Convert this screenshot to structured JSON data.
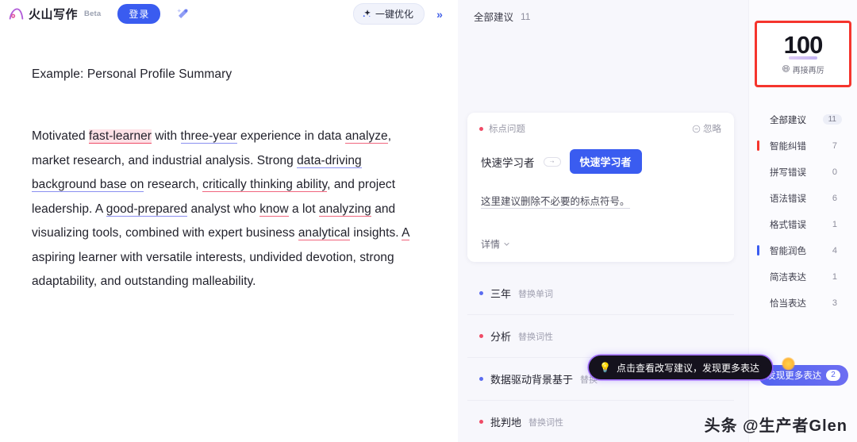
{
  "header": {
    "logo_text": "火山写作",
    "beta_tag": "Beta",
    "login_label": "登录",
    "magic_icon": "magic-wand-icon",
    "optimize_label": "一键优化",
    "spark_icon": "sparkle-icon",
    "expand_label": "»"
  },
  "document": {
    "title": "Example: Personal Profile Summary",
    "paragraph_segments": [
      {
        "text": "Motivated ",
        "mark": "none"
      },
      {
        "text": "fast-learner",
        "mark": "red-highlight"
      },
      {
        "text": " with ",
        "mark": "none"
      },
      {
        "text": "three-year",
        "mark": "blue"
      },
      {
        "text": " experience in data ",
        "mark": "none"
      },
      {
        "text": "analyze",
        "mark": "red"
      },
      {
        "text": ", market research, and industrial analysis. Strong ",
        "mark": "none"
      },
      {
        "text": "data-driving background base on",
        "mark": "blue"
      },
      {
        "text": " research, ",
        "mark": "none"
      },
      {
        "text": "critically thinking ability",
        "mark": "red"
      },
      {
        "text": ", and project leadership. A ",
        "mark": "none"
      },
      {
        "text": "good-prepared",
        "mark": "blue"
      },
      {
        "text": " analyst who ",
        "mark": "none"
      },
      {
        "text": "know",
        "mark": "red"
      },
      {
        "text": " a lot ",
        "mark": "none"
      },
      {
        "text": "analyzing",
        "mark": "red"
      },
      {
        "text": " and visualizing tools, combined with expert business ",
        "mark": "none"
      },
      {
        "text": "analytical",
        "mark": "red"
      },
      {
        "text": " insights. ",
        "mark": "none"
      },
      {
        "text": "A",
        "mark": "red"
      },
      {
        "text": " aspiring learner with versatile interests, undivided devotion, strong adaptability, and outstanding malleability.",
        "mark": "none"
      }
    ]
  },
  "suggestions": {
    "header_label": "全部建议",
    "header_count": "11",
    "card": {
      "type_label": "标点问题",
      "ignore_label": "忽略",
      "ignore_icon": "circle-minus-icon",
      "original": "快速学习者",
      "arrow_icon": "arrow-right-icon",
      "replacement": "快速学习者",
      "description": "这里建议删除不必要的标点符号。",
      "more_label": "详情",
      "chevron_icon": "chevron-down-icon"
    },
    "rows": [
      {
        "word": "三年",
        "kind": "替换单词",
        "dot": "blue"
      },
      {
        "word": "分析",
        "kind": "替换词性",
        "dot": "red"
      },
      {
        "word": "数据驱动背景基于",
        "kind": "替换",
        "dot": "blue"
      },
      {
        "word": "批判地",
        "kind": "替换词性",
        "dot": "red"
      }
    ]
  },
  "sidebar": {
    "score": "100",
    "score_emoji": "😄",
    "score_sub": "再接再厉",
    "items": [
      {
        "label": "全部建议",
        "count": "11",
        "style": "pill",
        "bar": "none"
      },
      {
        "label": "智能纠错",
        "count": "7",
        "style": "plain",
        "bar": "red"
      },
      {
        "label": "拼写错误",
        "count": "0",
        "style": "plain",
        "bar": "none"
      },
      {
        "label": "语法错误",
        "count": "6",
        "style": "plain",
        "bar": "none"
      },
      {
        "label": "格式错误",
        "count": "1",
        "style": "plain",
        "bar": "none"
      },
      {
        "label": "智能润色",
        "count": "4",
        "style": "plain",
        "bar": "blue"
      },
      {
        "label": "简洁表达",
        "count": "1",
        "style": "plain",
        "bar": "none"
      },
      {
        "label": "恰当表达",
        "count": "3",
        "style": "plain",
        "bar": "none"
      }
    ],
    "discover_label": "发现更多表达",
    "discover_badge": "2"
  },
  "tooltip": {
    "icon": "lightbulb-icon",
    "text": "点击查看改写建议，发现更多表达"
  },
  "watermark": "头条 @生产者Glen",
  "colors": {
    "brand_blue": "#3a5cf0",
    "error_red": "#ef4b66",
    "score_border": "#f5352d",
    "panel_bg": "#f7f7fc"
  }
}
